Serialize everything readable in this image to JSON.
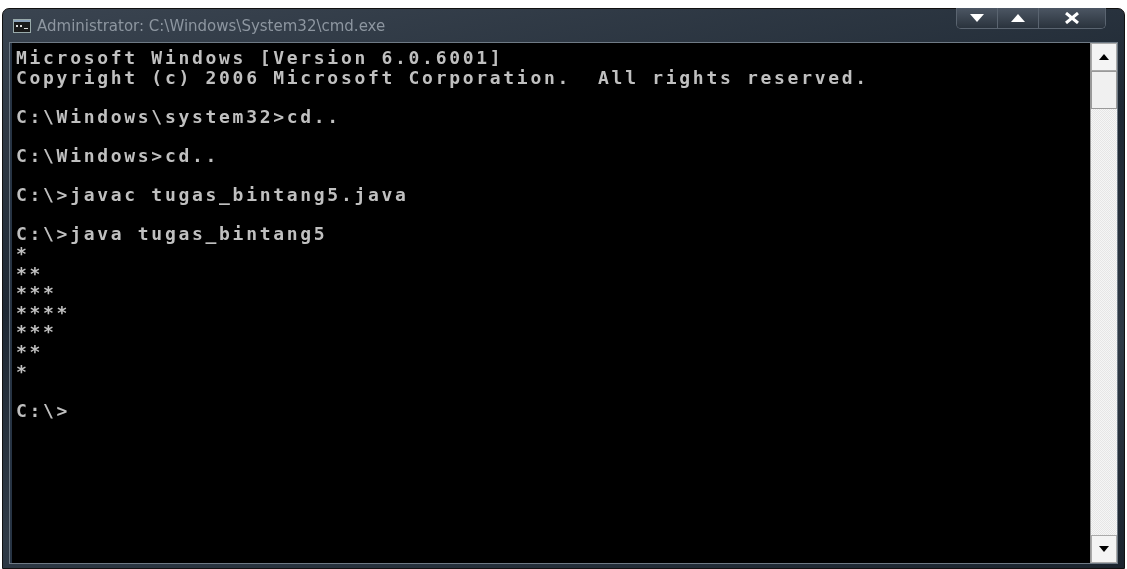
{
  "window": {
    "title": "Administrator: C:\\Windows\\System32\\cmd.exe"
  },
  "console": {
    "blocks": [
      "Microsoft Windows [Version 6.0.6001]\nCopyright (c) 2006 Microsoft Corporation.  All rights reserved.",
      "C:\\Windows\\system32>cd..",
      "C:\\Windows>cd..",
      "C:\\>javac tugas_bintang5.java",
      "C:\\>java tugas_bintang5\n*\n**\n***\n****\n***\n**\n*",
      "C:\\>"
    ]
  }
}
